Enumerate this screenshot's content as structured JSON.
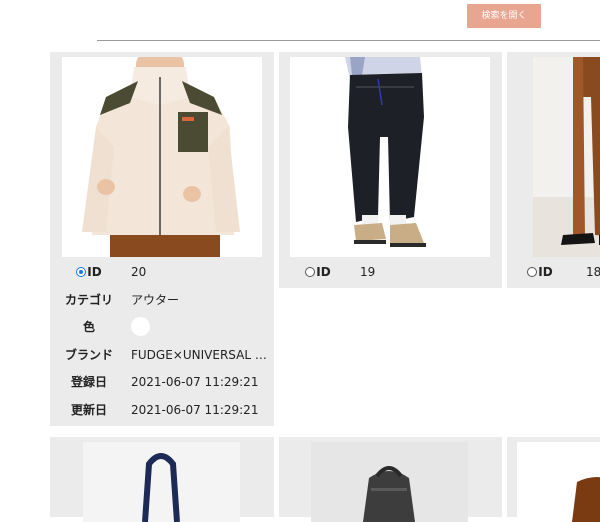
{
  "header": {
    "search_button_label": "検索を開く"
  },
  "cards": [
    {
      "id_label": "ID",
      "id_value": "20",
      "selected": true,
      "fields": {
        "category_label": "カテゴリ",
        "category_value": "アウター",
        "color_label": "色",
        "color_value": "#ffffff",
        "brand_label": "ブランド",
        "brand_value": "FUDGE×UNIVERSAL OVERALL",
        "registered_label": "登録日",
        "registered_value": "2021-06-07 11:29:21",
        "updated_label": "更新日",
        "updated_value": "2021-06-07 11:29:21"
      }
    },
    {
      "id_label": "ID",
      "id_value": "19",
      "selected": false
    },
    {
      "id_label": "ID",
      "id_value": "18",
      "selected": false
    }
  ],
  "colors": {
    "accent_button": "#e8a58f",
    "card_background": "#ebebeb",
    "radio_selected": "#1a73e8"
  }
}
